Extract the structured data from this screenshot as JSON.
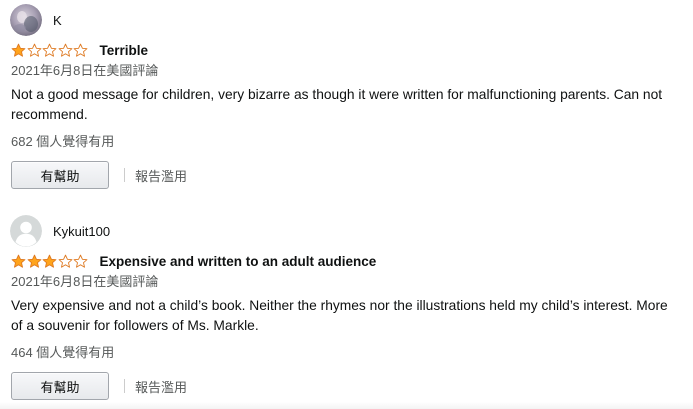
{
  "colors": {
    "star_fill": "#ffa41c",
    "star_outline": "#de7921",
    "text_primary": "#0f1111",
    "text_secondary": "#565959"
  },
  "reviews": [
    {
      "reviewer_name": "K",
      "avatar_icon": "avatar-photo-icon",
      "rating": 1,
      "max_rating": 5,
      "title": "Terrible",
      "date": "2021年6月8日在美國評論",
      "body": "Not a good message for children, very bizarre as though it were written for malfunctioning parents. Can not recommend.",
      "helpful_count": "682 個人覺得有用",
      "helpful_button_label": "有幫助",
      "report_label": "報告濫用"
    },
    {
      "reviewer_name": "Kykuit100",
      "avatar_icon": "default-user-icon",
      "rating": 3,
      "max_rating": 5,
      "title": "Expensive and written to an adult audience",
      "date": "2021年6月8日在美國評論",
      "body": "Very expensive and not a child’s book. Neither the rhymes nor the illustrations held my child’s interest. More of a souvenir for followers of Ms. Markle.",
      "helpful_count": "464 個人覺得有用",
      "helpful_button_label": "有幫助",
      "report_label": "報告濫用"
    }
  ]
}
